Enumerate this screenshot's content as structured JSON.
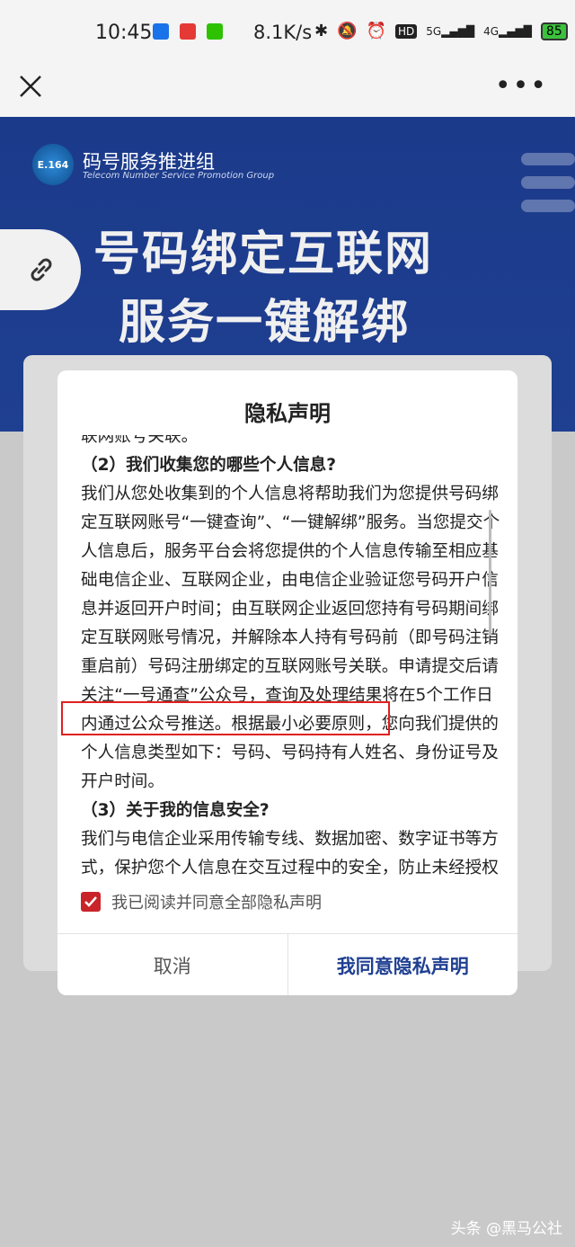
{
  "status": {
    "time": "10:45",
    "speed": "8.1K/s",
    "battery": "85",
    "net1": "5G",
    "net2": "4G"
  },
  "banner": {
    "org_cn": "码号服务推进组",
    "org_en": "Telecom Number Service Promotion Group",
    "logo_text": "E.164",
    "headline1": "号码绑定互联网",
    "headline2": "服务一键解绑"
  },
  "dialog": {
    "title": "隐私声明",
    "cut_line": "联网账号关联。",
    "heading2": "（2）我们收集您的哪些个人信息?",
    "para2": "我们从您处收集到的个人信息将帮助我们为您提供号码绑定互联网账号“一键查询”、“一键解绑”服务。当您提交个人信息后，服务平台会将您提供的个人信息传输至相应基础电信企业、互联网企业，由电信企业验证您号码开户信息并返回开户时间；由互联网企业返回您持有号码期间绑定互联网账号情况，并解除本人持有号码前（即号码注销重启前）号码注册绑定的互联网账号关联。申请提交后请关注“一号通查”公众号，查询及处理结果将在5个工作日内通过公众号推送。根据最小必要原则，您向我们提供的个人信息类型如下：号码、号码持有人姓名、身份证号及开户时间。",
    "heading3": "（3）关于我的信息安全?",
    "para3": "我们与电信企业采用传输专线、数据加密、数字证书等方式，保护您个人信息在交互过程中的安全，防止未经授权的访问与个人信息泄露或被篡改、损坏、丢失。",
    "agree_label": "我已阅读并同意全部隐私声明",
    "cancel_label": "取消",
    "ok_label": "我同意隐私声明"
  },
  "watermark": "头条 @黑马公社",
  "colors": {
    "banner_blue": "#1f3f91",
    "checkbox_red": "#c8242a",
    "highlight_red": "#e02020"
  }
}
